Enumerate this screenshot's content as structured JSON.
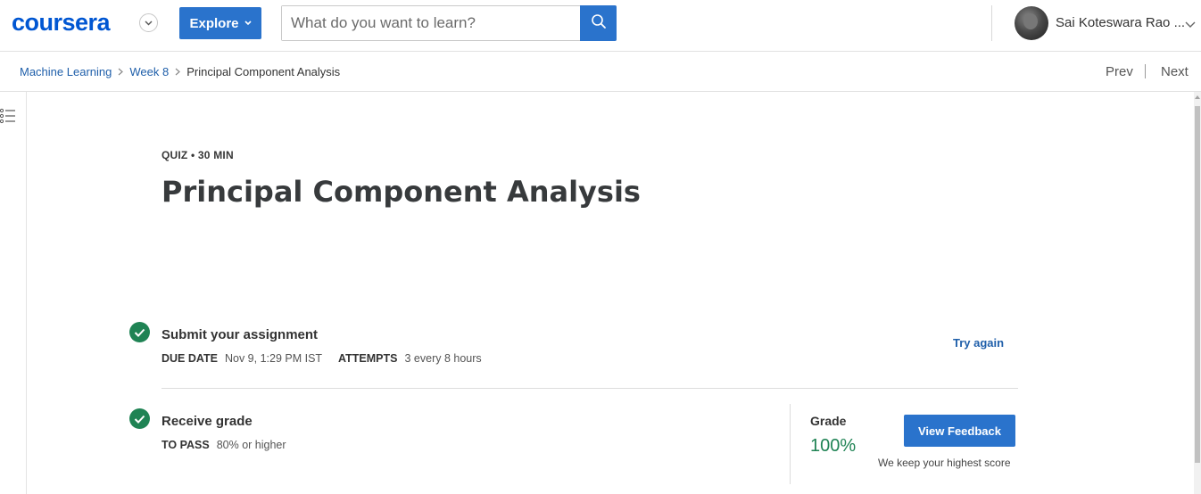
{
  "header": {
    "logo_text": "coursera",
    "explore_label": "Explore",
    "search_placeholder": "What do you want to learn?",
    "user_name": "Sai Koteswara Rao ...",
    "accent_color": "#2a73cc"
  },
  "breadcrumb": {
    "items": [
      "Machine Learning",
      "Week 8",
      "Principal Component Analysis"
    ],
    "prev_label": "Prev",
    "next_label": "Next"
  },
  "main": {
    "eyebrow": "QUIZ • 30 MIN",
    "title": "Principal Component Analysis",
    "submit": {
      "title": "Submit your assignment",
      "due_label": "DUE DATE",
      "due_value": "Nov 9, 1:29 PM IST",
      "attempts_label": "ATTEMPTS",
      "attempts_value": "3 every 8 hours",
      "try_again_label": "Try again"
    },
    "receive": {
      "title": "Receive grade",
      "pass_label": "TO PASS",
      "pass_value": "80% or higher"
    },
    "grade": {
      "label": "Grade",
      "value": "100%",
      "feedback_button": "View Feedback",
      "note": "We keep your highest score"
    }
  },
  "colors": {
    "success": "#1f8354",
    "link": "#1f5faa"
  },
  "icons": [
    "chevron-down-icon",
    "search-icon",
    "menu-list-icon",
    "check-circle-icon"
  ]
}
